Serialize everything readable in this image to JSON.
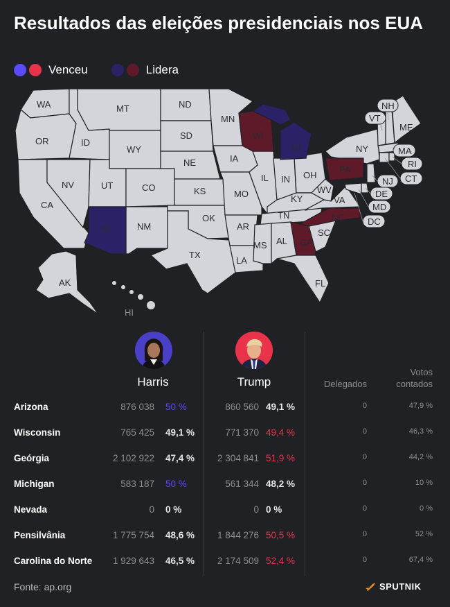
{
  "title": "Resultados das eleições presidenciais nos EUA",
  "legend": {
    "won_label": "Venceu",
    "leads_label": "Lidera"
  },
  "colors": {
    "harris_won": "#5a4bff",
    "trump_won": "#e8334a",
    "harris_leads": "#2a2166",
    "trump_leads": "#5e1a29",
    "neutral": "#d4d5db",
    "background": "#202125"
  },
  "map": {
    "state_labels": [
      "WA",
      "MT",
      "ND",
      "MN",
      "OR",
      "ID",
      "SD",
      "WI",
      "MI",
      "WY",
      "NE",
      "IA",
      "IL",
      "IN",
      "OH",
      "PA",
      "NY",
      "NV",
      "UT",
      "CO",
      "KS",
      "MO",
      "KY",
      "WV",
      "VA",
      "CA",
      "AZ",
      "NM",
      "OK",
      "AR",
      "TN",
      "NC",
      "SC",
      "GA",
      "AL",
      "MS",
      "LA",
      "TX",
      "FL",
      "AK",
      "HI",
      "ME",
      "NH",
      "VT",
      "MA",
      "RI",
      "CT",
      "NJ",
      "DE",
      "MD",
      "DC"
    ],
    "highlighted": {
      "AZ": "harris_won",
      "WI": "trump_leads",
      "MI": "harris_leads",
      "PA": "trump_leads",
      "NC": "trump_leads",
      "GA": "trump_leads"
    }
  },
  "candidates": [
    {
      "name": "Harris",
      "avatar_icon": "harris-portrait"
    },
    {
      "name": "Trump",
      "avatar_icon": "trump-portrait"
    }
  ],
  "columns": {
    "delegates": "Delegados",
    "votes_counted": "Votos contados"
  },
  "rows": [
    {
      "state": "Arizona",
      "harris_votes": "876 038",
      "harris_pct": "50 %",
      "trump_votes": "860 560",
      "trump_pct": "49,1 %",
      "leader": "harris",
      "delegates": "0",
      "counted": "47,9 %"
    },
    {
      "state": "Wisconsin",
      "harris_votes": "765 425",
      "harris_pct": "49,1 %",
      "trump_votes": "771 370",
      "trump_pct": "49,4 %",
      "leader": "trump",
      "delegates": "0",
      "counted": "46,3 %"
    },
    {
      "state": "Geórgia",
      "harris_votes": "2 102 922",
      "harris_pct": "47,4 %",
      "trump_votes": "2 304 841",
      "trump_pct": "51,9 %",
      "leader": "trump",
      "delegates": "0",
      "counted": "44,2 %"
    },
    {
      "state": "Michigan",
      "harris_votes": "583 187",
      "harris_pct": "50 %",
      "trump_votes": "561 344",
      "trump_pct": "48,2 %",
      "leader": "harris",
      "delegates": "0",
      "counted": "10 %"
    },
    {
      "state": "Nevada",
      "harris_votes": "0",
      "harris_pct": "0 %",
      "trump_votes": "0",
      "trump_pct": "0 %",
      "leader": "none",
      "delegates": "0",
      "counted": "0 %"
    },
    {
      "state": "Pensilvânia",
      "harris_votes": "1 775 754",
      "harris_pct": "48,6 %",
      "trump_votes": "1 844 276",
      "trump_pct": "50,5 %",
      "leader": "trump",
      "delegates": "0",
      "counted": "52 %"
    },
    {
      "state": "Carolina do Norte",
      "harris_votes": "1 929 643",
      "harris_pct": "46,5 %",
      "trump_votes": "2 174 509",
      "trump_pct": "52,4 %",
      "leader": "trump",
      "delegates": "0",
      "counted": "67,4 %"
    }
  ],
  "footer": {
    "source": "Fonte: ap.org",
    "brand": "SPUTNIK",
    "brand_icon": "sputnik-logo-icon"
  }
}
